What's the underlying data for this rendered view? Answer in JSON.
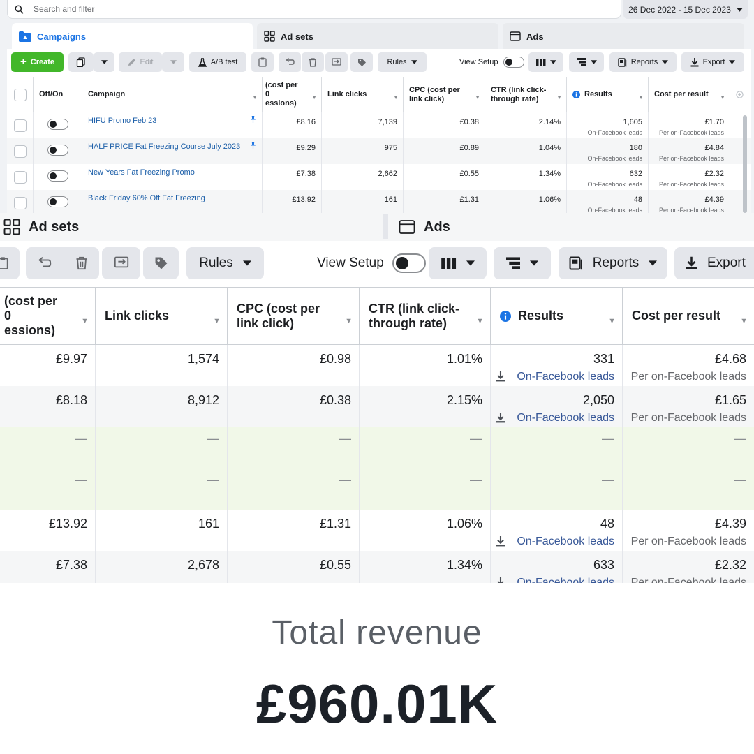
{
  "top": {
    "search_placeholder": "Search and filter",
    "date_range": "26 Dec 2022 - 15 Dec 2023",
    "tabs": {
      "campaigns": "Campaigns",
      "ad_sets": "Ad sets",
      "ads": "Ads"
    },
    "toolbar": {
      "create": "Create",
      "edit": "Edit",
      "ab_test": "A/B test",
      "rules": "Rules",
      "view_setup": "View Setup",
      "reports": "Reports",
      "export": "Export"
    },
    "headers": {
      "off_on": "Off/On",
      "campaign": "Campaign",
      "cpm_line1": "(cost per",
      "cpm_line2": "0",
      "cpm_line3": "essions)",
      "link_clicks": "Link clicks",
      "cpc": "CPC (cost per link click)",
      "ctr": "CTR (link click-through rate)",
      "results": "Results",
      "cost_per_result": "Cost per result"
    },
    "rows": [
      {
        "campaign": "HIFU Promo Feb 23",
        "cpm": "£8.16",
        "link_clicks": "7,139",
        "cpc": "£0.38",
        "ctr": "2.14%",
        "results": "1,605",
        "results_type": "On-Facebook leads",
        "cost": "£1.70",
        "cost_type": "Per on-Facebook leads"
      },
      {
        "campaign": "HALF PRICE Fat Freezing Course July 2023",
        "cpm": "£9.29",
        "link_clicks": "975",
        "cpc": "£0.89",
        "ctr": "1.04%",
        "results": "180",
        "results_type": "On-Facebook leads",
        "cost": "£4.84",
        "cost_type": "Per on-Facebook leads"
      },
      {
        "campaign": "New Years Fat Freezing Promo",
        "cpm": "£7.38",
        "link_clicks": "2,662",
        "cpc": "£0.55",
        "ctr": "1.34%",
        "results": "632",
        "results_type": "On-Facebook leads",
        "cost": "£2.32",
        "cost_type": "Per on-Facebook leads"
      },
      {
        "campaign": "Black Friday 60% Off Fat Freezing",
        "cpm": "£13.92",
        "link_clicks": "161",
        "cpc": "£1.31",
        "ctr": "1.06%",
        "results": "48",
        "results_type": "On-Facebook leads",
        "cost": "£4.39",
        "cost_type": "Per on-Facebook leads"
      }
    ]
  },
  "zoom": {
    "tabs": {
      "ad_sets": "Ad sets",
      "ads": "Ads"
    },
    "toolbar": {
      "rules": "Rules",
      "view_setup": "View Setup",
      "reports": "Reports",
      "export": "Export"
    },
    "headers": {
      "cpm_line1": "(cost per",
      "cpm_line2": "0",
      "cpm_line3": "essions)",
      "link_clicks": "Link clicks",
      "cpc_line1": "CPC (cost per",
      "cpc_line2": "link click)",
      "ctr_line1": "CTR (link click-",
      "ctr_line2": "through rate)",
      "results": "Results",
      "cost_per_result": "Cost per result"
    },
    "rows": [
      {
        "cpm": "£9.97",
        "link_clicks": "1,574",
        "cpc": "£0.98",
        "ctr": "1.01%",
        "results": "331",
        "results_type": "On-Facebook leads",
        "cost": "£4.68",
        "cost_type": "Per on-Facebook leads"
      },
      {
        "cpm": "£8.18",
        "link_clicks": "8,912",
        "cpc": "£0.38",
        "ctr": "2.15%",
        "results": "2,050",
        "results_type": "On-Facebook leads",
        "cost": "£1.65",
        "cost_type": "Per on-Facebook leads"
      },
      {
        "cpm": "—",
        "link_clicks": "—",
        "cpc": "—",
        "ctr": "—",
        "results": "—",
        "cost": "—"
      },
      {
        "cpm": "—",
        "link_clicks": "—",
        "cpc": "—",
        "ctr": "—",
        "results": "—",
        "cost": "—"
      },
      {
        "cpm": "£13.92",
        "link_clicks": "161",
        "cpc": "£1.31",
        "ctr": "1.06%",
        "results": "48",
        "results_type": "On-Facebook leads",
        "cost": "£4.39",
        "cost_type": "Per on-Facebook leads"
      },
      {
        "cpm": "£7.38",
        "link_clicks": "2,678",
        "cpc": "£0.55",
        "ctr": "1.34%",
        "results": "633",
        "results_type": "On-Facebook leads",
        "cost": "£2.32",
        "cost_type": "Per on-Facebook leads"
      }
    ]
  },
  "revenue": {
    "label": "Total revenue",
    "value": "£960.01K"
  },
  "colors": {
    "accent": "#1b74e4",
    "create_green": "#42b72a",
    "link": "#1b5ea8",
    "green_row": "#f1f8e8"
  }
}
